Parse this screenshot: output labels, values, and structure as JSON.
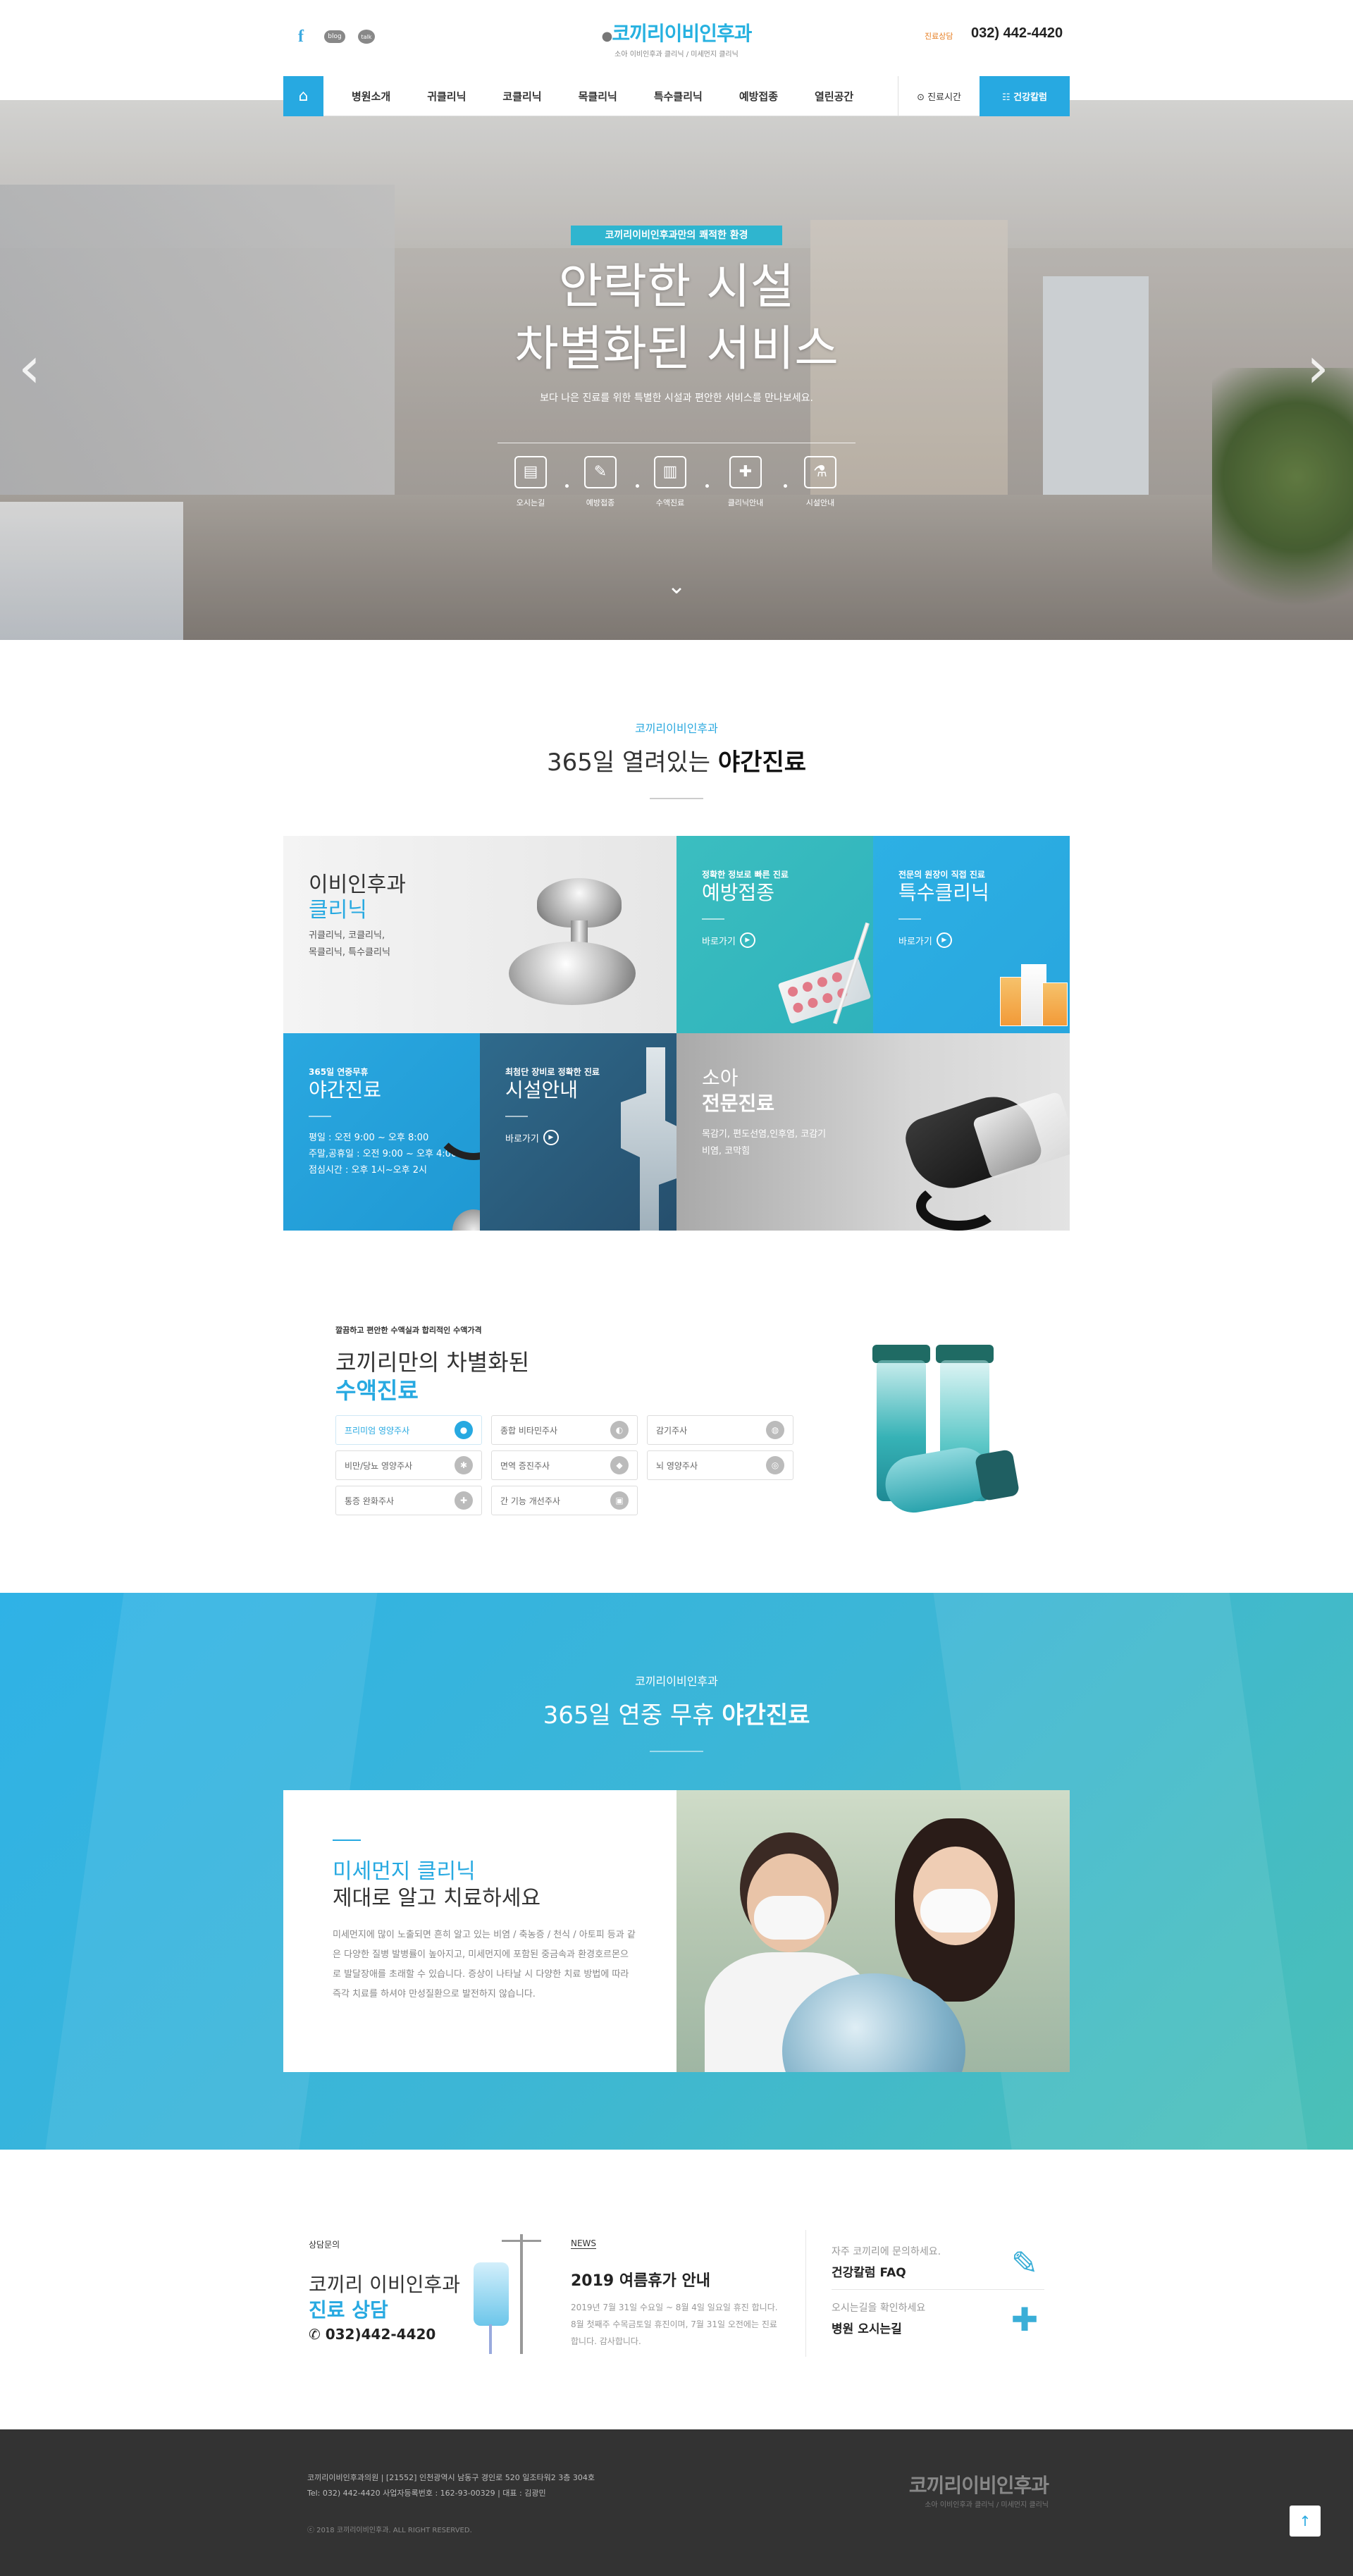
{
  "header": {
    "sns": {
      "facebook": "f",
      "blog": "blog",
      "talk": "talk"
    },
    "logo": {
      "name_1": "코끼리",
      "name_2": "이비인후과",
      "tagline": "소아 이비인후과 클리닉 / 미세먼지 클리닉"
    },
    "phone_label": "진료상담",
    "phone": "032) 442-4420"
  },
  "nav": {
    "home_icon": "home-icon",
    "items": [
      "병원소개",
      "귀클리닉",
      "코클리닉",
      "목클리닉",
      "특수클리닉",
      "예방접종",
      "열린공간"
    ],
    "time_label": "⊙ 진료시간",
    "health_label": "☷ 건강칼럼"
  },
  "hero": {
    "tag": "코끼리이비인후과만의 쾌적한 환경",
    "title_1": "안락한 시설",
    "title_2": "차별화된 서비스",
    "subtitle": "보다 나은 진료를 위한 특별한 시설과 편안한 서비스를 만나보세요.",
    "icons": [
      {
        "label": "오시는길",
        "icon": "map-board-icon"
      },
      {
        "label": "예방접종",
        "icon": "syringe-icon"
      },
      {
        "label": "수액진료",
        "icon": "iv-bag-icon"
      },
      {
        "label": "클리닉안내",
        "icon": "medical-kit-icon"
      },
      {
        "label": "시설안내",
        "icon": "microscope-icon"
      }
    ]
  },
  "section1": {
    "small": "코끼리이비인후과",
    "title_prefix": "365일 열려있는 ",
    "title_bold": "야간진료"
  },
  "grid": {
    "clinic": {
      "t1": "이비인후과",
      "t2": "클리닉",
      "l1": "귀클리닉, 코클리닉,",
      "l2": "목클리닉, 특수클리닉"
    },
    "vaccine": {
      "small": "정확한 정보로 빠른 진료",
      "title": "예방접종",
      "go": "바로가기"
    },
    "special": {
      "small": "전문의 원장이 직접 진료",
      "title": "특수클리닉",
      "go": "바로가기"
    },
    "night": {
      "small": "365일 연중무휴",
      "title": "야간진료",
      "l1": "평일 : 오전 9:00 ~ 오후 8:00",
      "l2": "주말,공휴일 : 오전 9:00 ~ 오후 4:00",
      "l3": "점심시간 : 오후 1시~오후 2시"
    },
    "facility": {
      "small": "최첨단 장비로 정확한 진료",
      "title": "시설안내",
      "go": "바로가기"
    },
    "pediatric": {
      "t1": "소아",
      "t2": "전문진료",
      "l1": "목감기, 편도선염,인후염, 코감기",
      "l2": "비염, 코막힘"
    }
  },
  "iv": {
    "small": "깔끔하고 편안한 수액실과 합리적인 수액가격",
    "title_1": "코끼리만의 차별화된",
    "title_2": "수액진료",
    "tags": [
      {
        "label": "프리미엄 영양주사",
        "icon": "drop-icon",
        "active": true
      },
      {
        "label": "종합 비타민주사",
        "icon": "pill-icon",
        "active": false
      },
      {
        "label": "감기주사",
        "icon": "capsule-icon",
        "active": false
      },
      {
        "label": "비만/당뇨 영양주사",
        "icon": "body-icon",
        "active": false
      },
      {
        "label": "면역 증진주사",
        "icon": "shield-icon",
        "active": false
      },
      {
        "label": "뇌 영양주사",
        "icon": "brain-icon",
        "active": false
      },
      {
        "label": "통증 완화주사",
        "icon": "bandage-icon",
        "active": false
      },
      {
        "label": "간 기능 개선주사",
        "icon": "liver-icon",
        "active": false
      }
    ]
  },
  "blue": {
    "small": "코끼리이비인후과",
    "title_prefix": "365일 연중 무휴 ",
    "title_bold": "야간진료",
    "dust": {
      "t1": "미세먼지 클리닉",
      "t2": "제대로 알고 치료하세요",
      "p": "미세먼지에 많이 노출되면 흔히 알고 있는 비염 / 축농증 / 천식 / 아토피 등과 같은 다양한 질병 발병률이 높아지고, 미세먼지에 포함된 중금속과 환경호르몬으로 발달장애를 초래할 수 있습니다. 증상이 나타날 시 다양한 치료 방법에 따라 즉각 치료를 하셔야 만성질환으로 발전하지 않습니다."
    }
  },
  "consult": {
    "small": "상담문의",
    "t1": "코끼리 이비인후과",
    "t2": "진료 상담",
    "tel": "✆ 032)442-4420"
  },
  "news": {
    "small": "NEWS",
    "title": "2019 여름휴가 안내",
    "body": "2019년 7월 31일 수요일 ~ 8월 4일 일요일 휴진 합니다. 8월 첫째주 수목금토일 휴진이며, 7월 31일 오전에는 진료 합니다.  감사합니다."
  },
  "faq": [
    {
      "small": "자주 코끼리에 문의하세요.",
      "big": "건강칼럼 FAQ",
      "icon": "clipboard-icon"
    },
    {
      "small": "오시는길을 확인하세요",
      "big": "병원 오시는길",
      "icon": "hospital-icon"
    }
  ],
  "footer": {
    "line1": "코끼리이비인후과의원   |   [21552] 인천광역시 남동구 경인로 520 일조타워2 3층 304호",
    "line2": "Tel: 032) 442-4420  사업자등록번호 : 162-93-00329   |   대표 : 김광민",
    "copy": "ⓒ 2018 코끼리이비인후과. ALL RIGHT RESERVED.",
    "logo_1": "코끼리",
    "logo_2": "이비인후과",
    "tagline": "소아 이비인후과 클리닉 / 미세먼지 클리닉",
    "top": "↑"
  },
  "colors": {
    "accent": "#27a9e1",
    "teal": "#3bbec0",
    "navy": "#264f6d",
    "footer": "#333333"
  }
}
